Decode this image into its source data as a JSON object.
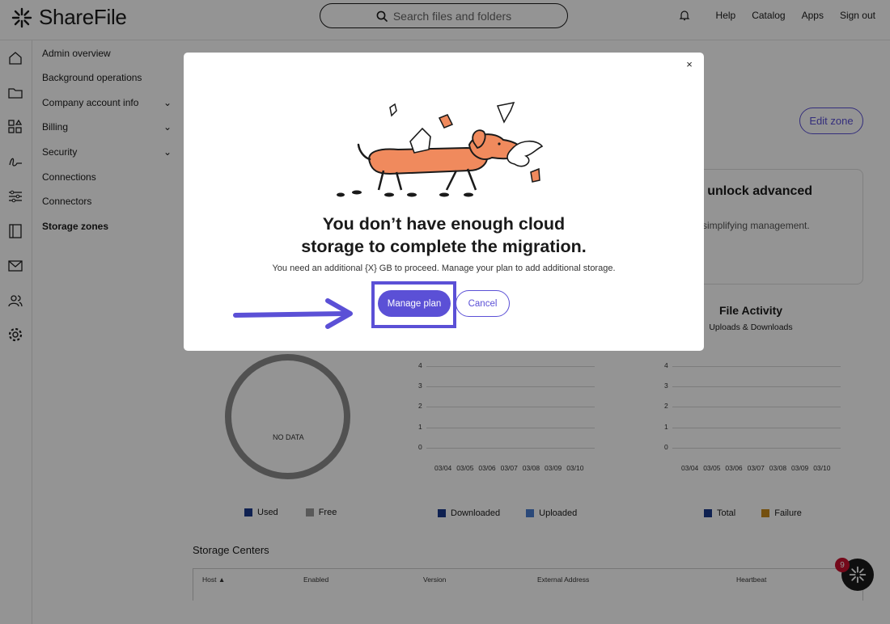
{
  "app": {
    "logo_text": "ShareFile",
    "search_placeholder": "Search files and folders",
    "top_nav": [
      "Help",
      "Catalog",
      "Apps",
      "Sign out"
    ]
  },
  "rail_icons": [
    "home-icon",
    "folder-icon",
    "apps-icon",
    "signature-icon",
    "workflow-icon",
    "panel-icon",
    "mail-icon",
    "users-icon",
    "settings-icon"
  ],
  "subnav": {
    "items": [
      {
        "label": "Admin overview",
        "expandable": false
      },
      {
        "label": "Background operations",
        "expandable": false
      },
      {
        "label": "Company account info",
        "expandable": true
      },
      {
        "label": "Billing",
        "expandable": true
      },
      {
        "label": "Security",
        "expandable": true
      },
      {
        "label": "Connections",
        "expandable": false
      },
      {
        "label": "Connectors",
        "expandable": false
      },
      {
        "label": "Storage zones",
        "expandable": false,
        "active": true
      }
    ]
  },
  "main": {
    "edit_zone_label": "Edit zone",
    "promo_title": "o unlock advanced",
    "promo_text": "simplifying management.",
    "file_activity_title": "File Activity",
    "file_activity_subtitle": "Uploads & Downloads",
    "donut_label": "NO DATA",
    "storage_legend": [
      "Used",
      "Free"
    ],
    "transfer_legend": [
      "Downloaded",
      "Uploaded"
    ],
    "activity_legend": [
      "Total",
      "Failure"
    ],
    "storage_centers_title": "Storage Centers",
    "table_headers": [
      "Host ▲",
      "Enabled",
      "Version",
      "External Address",
      "Heartbeat"
    ],
    "helper_badge": "9"
  },
  "chart_data": [
    {
      "type": "line",
      "x": [
        "03/04",
        "03/05",
        "03/06",
        "03/07",
        "03/08",
        "03/09",
        "03/10"
      ],
      "y_ticks": [
        0,
        1,
        2,
        3,
        4
      ],
      "series": [
        {
          "name": "Downloaded",
          "values": []
        },
        {
          "name": "Uploaded",
          "values": []
        }
      ]
    },
    {
      "type": "line",
      "title": "File Activity",
      "subtitle": "Uploads & Downloads",
      "x": [
        "03/04",
        "03/05",
        "03/06",
        "03/07",
        "03/08",
        "03/09",
        "03/10"
      ],
      "y_ticks": [
        0,
        1,
        2,
        3,
        4
      ],
      "series": [
        {
          "name": "Total",
          "values": []
        },
        {
          "name": "Failure",
          "values": []
        }
      ]
    }
  ],
  "colors": {
    "accent": "#5b50d6",
    "legend_dark_blue": "#1b3a8c",
    "legend_light_blue": "#4a7fd1",
    "legend_grey": "#9a9a9a",
    "legend_orange": "#c98a1a",
    "illustration_dog": "#f08a5d"
  },
  "modal": {
    "title_line1": "You don’t have enough cloud",
    "title_line2": "storage to complete the migration.",
    "body": "You need an additional {X} GB to proceed. Manage your plan to add additional storage.",
    "primary_button": "Manage plan",
    "secondary_button": "Cancel",
    "close_glyph": "×"
  }
}
